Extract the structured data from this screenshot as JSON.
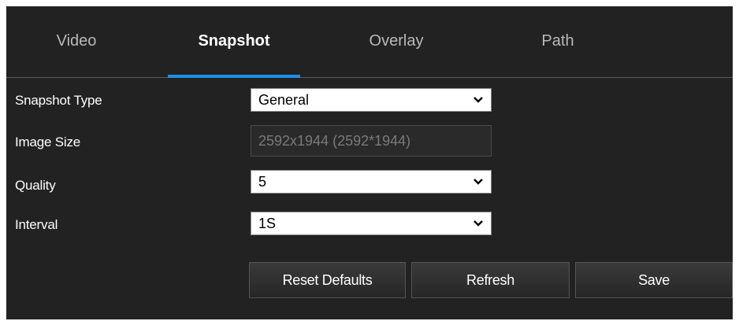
{
  "tabs": [
    {
      "label": "Video",
      "active": false
    },
    {
      "label": "Snapshot",
      "active": true
    },
    {
      "label": "Overlay",
      "active": false
    },
    {
      "label": "Path",
      "active": false
    }
  ],
  "form": {
    "snapshot_type": {
      "label": "Snapshot Type",
      "value": "General"
    },
    "image_size": {
      "label": "Image Size",
      "value": "2592x1944 (2592*1944)"
    },
    "quality": {
      "label": "Quality",
      "value": "5"
    },
    "interval": {
      "label": "Interval",
      "value": "1S"
    }
  },
  "buttons": {
    "reset_defaults": "Reset Defaults",
    "refresh": "Refresh",
    "save": "Save"
  },
  "colors": {
    "panel_bg": "#222222",
    "active_tab_underline": "#1e90e8"
  }
}
